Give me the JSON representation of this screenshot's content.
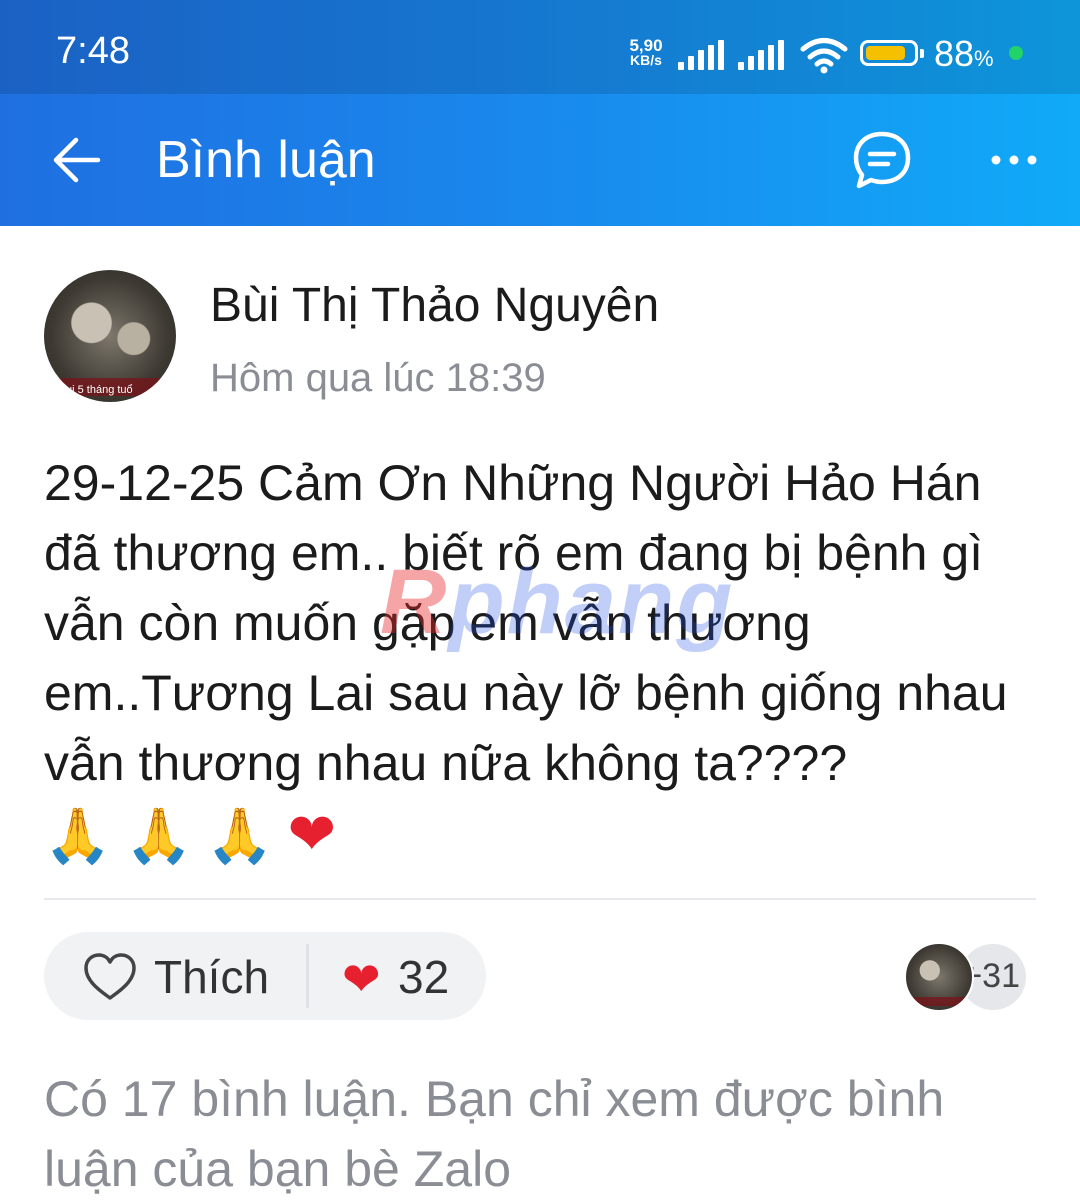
{
  "status_bar": {
    "time": "7:48",
    "net_speed_value": "5,90",
    "net_speed_unit": "KB/s",
    "battery_percent": "88",
    "battery_unit": "%",
    "battery_level": 0.88,
    "icons": [
      "signal-icon",
      "signal-icon",
      "wifi-icon",
      "battery-icon",
      "charging-dot-icon"
    ]
  },
  "header": {
    "title": "Bình luận",
    "back_icon": "arrow-left-icon",
    "chat_icon": "chat-bubble-icon",
    "more_icon": "more-horizontal-icon",
    "background_colors": [
      "#1f6fe0",
      "#10aaf8"
    ]
  },
  "post": {
    "author": "Bùi Thị Thảo Nguyên",
    "avatar_caption": "ui 5 tháng tuổ",
    "time": "Hôm qua lúc 18:39",
    "text": "29-12-25 Cảm Ơn Những Người Hảo Hán đã thương em.. biết rõ em đang bị bệnh gì vẫn còn muốn gặp em vẫn thương em..Tương Lai sau này lỡ bệnh giống nhau vẫn thương nhau nữa không ta????",
    "emojis": [
      "🙏",
      "🙏",
      "🙏",
      "❤"
    ],
    "watermark": {
      "first": "R",
      "rest": "phang"
    }
  },
  "reactions": {
    "like_label": "Thích",
    "like_icon": "heart-outline-icon",
    "reaction_icon": "heart-filled-icon",
    "reaction_symbol": "❤",
    "count": "32",
    "more_reactors": "+31"
  },
  "comments": {
    "notice": "Có 17 bình luận. Bạn chỉ xem được bình luận của bạn bè Zalo"
  }
}
